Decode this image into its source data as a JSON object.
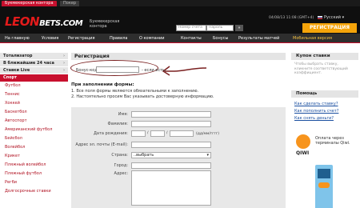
{
  "top_tabs": {
    "active": "Букмекерская контора",
    "inactive": "Покер"
  },
  "header": {
    "logo_main": "LEON",
    "logo_sub": "BETS.COM",
    "tagline": "Букмекерская контора",
    "datetime": "04/08/13 11:08 (GMT+4)",
    "language": "Русский",
    "account_placeholder": "Номер счета",
    "password_placeholder": "Пароль",
    "login_button": "»",
    "register_button": "РЕГИСТРАЦИЯ"
  },
  "nav": {
    "items": [
      "На главную",
      "Условия",
      "Регистрация",
      "Правила",
      "О компании",
      "Контакты",
      "Бонусы",
      "Результаты матчей",
      "Мобильная версия"
    ]
  },
  "left_sidebar": {
    "sections": [
      "Тотализатор",
      "В ближайшие 24 часа",
      "Ставки Live"
    ],
    "sport_header": "Спорт",
    "sports": [
      "Футбол",
      "Теннис",
      "Хоккей",
      "Баскетбол",
      "Автоспорт",
      "Американский футбол",
      "Бейсбол",
      "Волейбол",
      "Крикет",
      "Пляжный волейбол",
      "Пляжный футбол",
      "Регби",
      "Долгосрочные ставки"
    ]
  },
  "main": {
    "title": "Регистрация",
    "promo_label": "Бонус-код:",
    "promo_note": "- если есть.",
    "rules_title": "При заполнении формы:",
    "rules": [
      "1. Все поля формы являются обязательными к заполнению.",
      "2. Настоятельно просим Вас указывать достоверную информацию."
    ],
    "form": {
      "name_label": "Имя:",
      "surname_label": "Фамилия:",
      "birthdate_label": "Дата рождения:",
      "birthdate_hint": "(дд/мм/гггг)",
      "date_sep": "/",
      "email_label": "Адрес эл. почты (E-mail):",
      "country_label": "Страна:",
      "country_value": "..выбрать",
      "city_label": "Город:",
      "address_label": "Адрес:"
    }
  },
  "right_sidebar": {
    "coupon_title": "Купон ставки",
    "coupon_text": "Чтобы выбрать ставку, кликните соответствующий коэффициент.",
    "help_title": "Помощь",
    "help_links": [
      "Как сделать ставку?",
      "Как пополнить счет?",
      "Как снять деньги?"
    ],
    "qiwi_text": "Оплата через терминалы Qiwi.",
    "qiwi_logo": "QIWI"
  },
  "colors": {
    "brand_red": "#c8102e",
    "register_orange": "#f5a40a",
    "link_blue": "#1a4fa0",
    "qiwi_orange": "#f7941d"
  }
}
